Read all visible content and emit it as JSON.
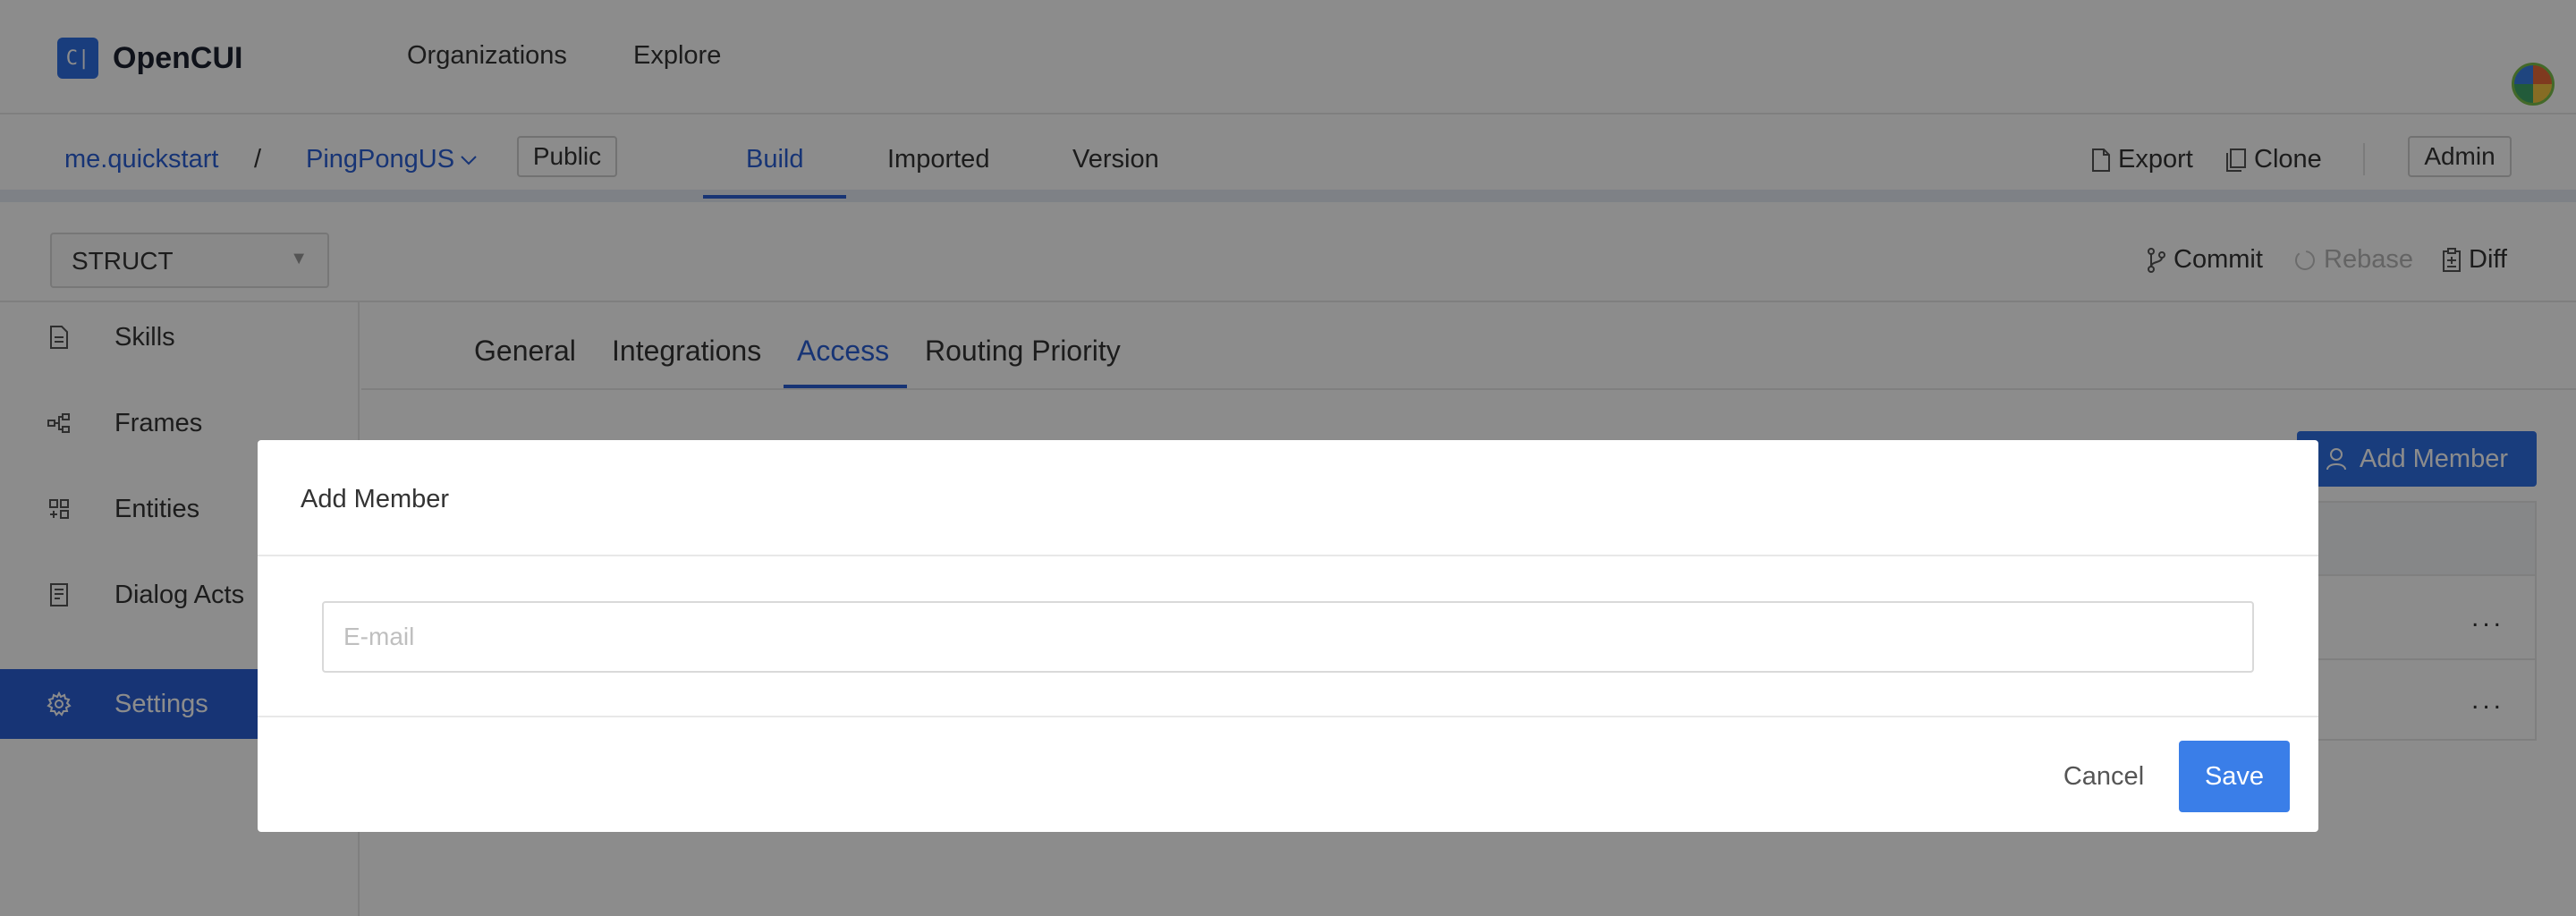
{
  "app": {
    "logo_glyph": "C|",
    "name": "OpenCUI"
  },
  "topnav": {
    "items": [
      "Organizations",
      "Explore"
    ]
  },
  "project": {
    "org": "me.quickstart",
    "separator": "/",
    "name": "PingPongUS",
    "visibility": "Public",
    "tabs": [
      "Build",
      "Imported",
      "Version"
    ],
    "active_tab": "Build",
    "actions": {
      "export": "Export",
      "clone": "Clone"
    },
    "role": "Admin"
  },
  "toolbar": {
    "select_value": "STRUCT",
    "commit": "Commit",
    "rebase": "Rebase",
    "diff": "Diff"
  },
  "sidebar": {
    "items": [
      {
        "label": "Skills",
        "icon": "file-icon"
      },
      {
        "label": "Frames",
        "icon": "frames-icon"
      },
      {
        "label": "Entities",
        "icon": "entities-icon"
      },
      {
        "label": "Dialog Acts",
        "icon": "dialog-acts-icon"
      },
      {
        "label": "Settings",
        "icon": "gear-icon"
      }
    ],
    "active": "Settings"
  },
  "settings": {
    "tabs": [
      "General",
      "Integrations",
      "Access",
      "Routing Priority"
    ],
    "active_tab": "Access",
    "add_member_label": "Add Member",
    "row_more": "..."
  },
  "modal": {
    "title": "Add Member",
    "email_placeholder": "E-mail",
    "email_value": "",
    "cancel_label": "Cancel",
    "save_label": "Save"
  },
  "colors": {
    "primary": "#2a5fd6",
    "button_blue": "#3a7ee8",
    "overlay": "rgba(0,0,0,0.45)"
  }
}
